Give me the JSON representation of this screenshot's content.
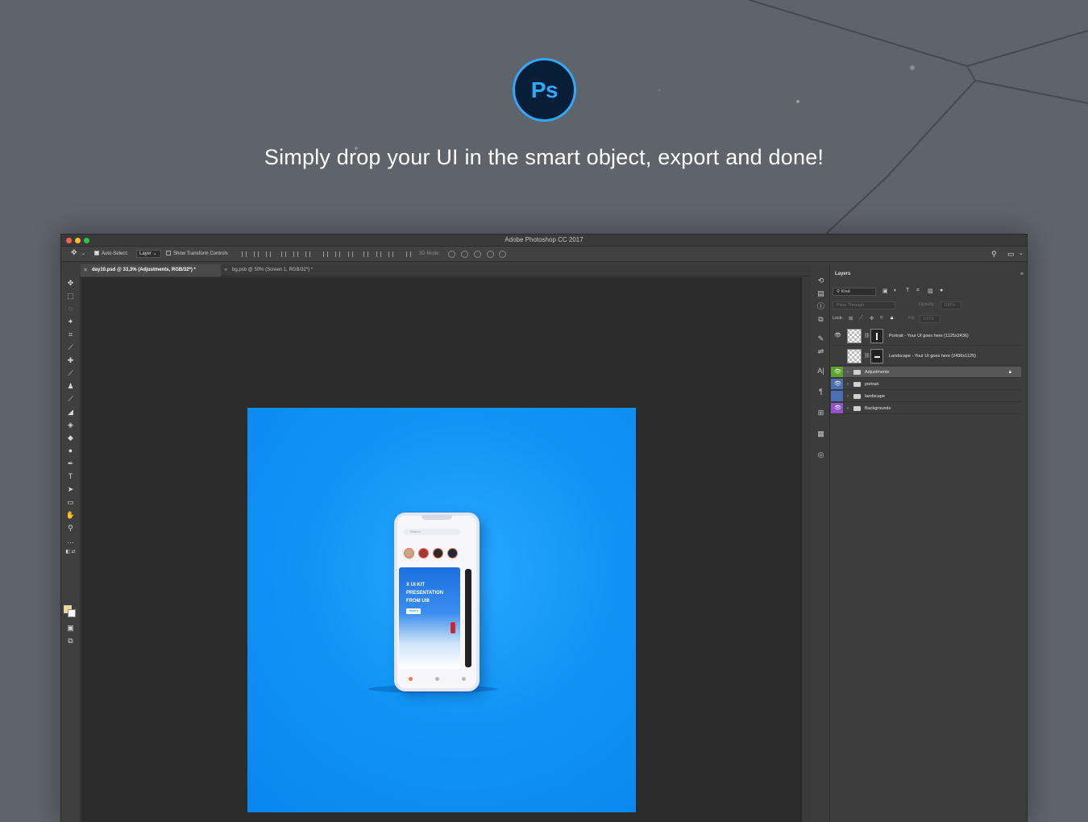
{
  "app": {
    "logo_text": "Ps",
    "headline": "Simply drop your UI in the smart object, export and done!",
    "window_title": "Adobe Photoshop CC 2017"
  },
  "options_bar": {
    "auto_select_label": "Auto-Select:",
    "auto_select_value": "Layer",
    "show_transform_label": "Show Transform Controls",
    "mode_3d_label": "3D Mode:"
  },
  "tabs": [
    {
      "label": "day10.psd @ 33,3% (Adjustments, RGB/32*) *",
      "active": true
    },
    {
      "label": "bg.psb @ 50% (Screen 1, RGB/32*) *",
      "active": false
    }
  ],
  "canvas": {
    "doc_color": "#1195f5",
    "mockup": {
      "search_text": "Search",
      "card_title": "X UI KIT PRESENTATION FROM UI8",
      "card_button": "Read it"
    }
  },
  "layers_panel": {
    "title": "Layers",
    "filter_kind": "Kind",
    "blend_mode": "Pass Through",
    "opacity_label": "Opacity:",
    "opacity_value": "100%",
    "lock_label": "Lock:",
    "fill_label": "Fill:",
    "fill_value": "100%",
    "layers": [
      {
        "name": "Portrait - Your UI goes here (1125x2436)",
        "type": "smart",
        "visible": true
      },
      {
        "name": "Landscape - Your UI goes here (2436x1125)",
        "type": "smart",
        "visible": false
      },
      {
        "name": "Adjustments",
        "type": "group",
        "visible": true,
        "color": "#5ba32b",
        "selected": true,
        "locked": true
      },
      {
        "name": "portrait",
        "type": "group",
        "visible": true,
        "color": "#4a6fb3"
      },
      {
        "name": "landscape",
        "type": "group",
        "visible": false,
        "color": "#4a6fb3"
      },
      {
        "name": "Backgrounds",
        "type": "group",
        "visible": true,
        "color": "#8e55c9"
      }
    ]
  },
  "colors": {
    "ps_blue": "#31a8ff",
    "ps_navy": "#061e36",
    "foreground_swatch": "#f6d98b",
    "background_swatch": "#ffffff"
  }
}
